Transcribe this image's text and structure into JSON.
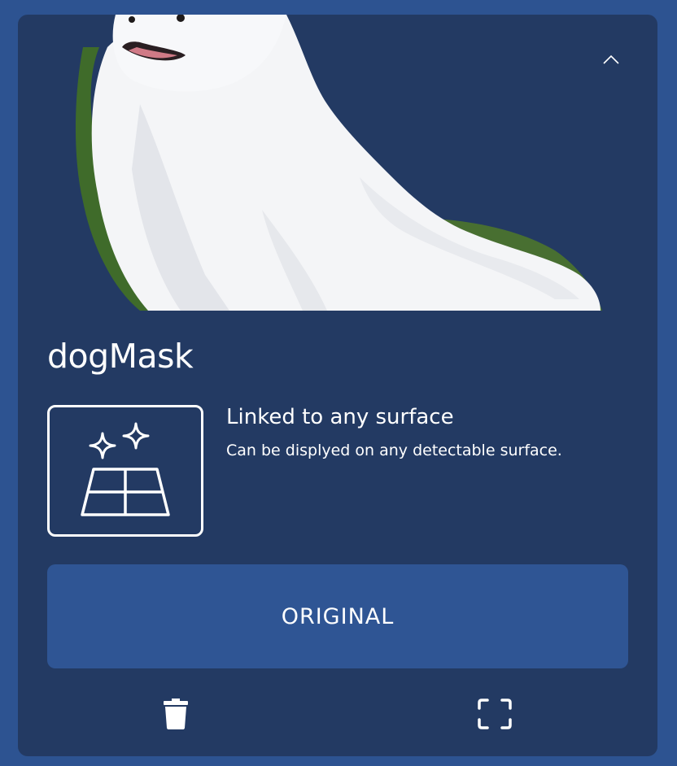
{
  "preview": {
    "image_alt": "white fluffy dog",
    "collapse_icon": "chevron-up-icon"
  },
  "mask": {
    "title": "dogMask"
  },
  "surface": {
    "icon": "surface-sparkle-icon",
    "title": "Linked to any surface",
    "description": "Can be displyed on any detectable surface."
  },
  "actions": {
    "original_label": "ORIGINAL",
    "delete_icon": "trash-icon",
    "fullscreen_icon": "fullscreen-icon"
  },
  "colors": {
    "background": "#2d5391",
    "card": "#233a63",
    "button": "#2f5594",
    "text": "#ffffff"
  }
}
